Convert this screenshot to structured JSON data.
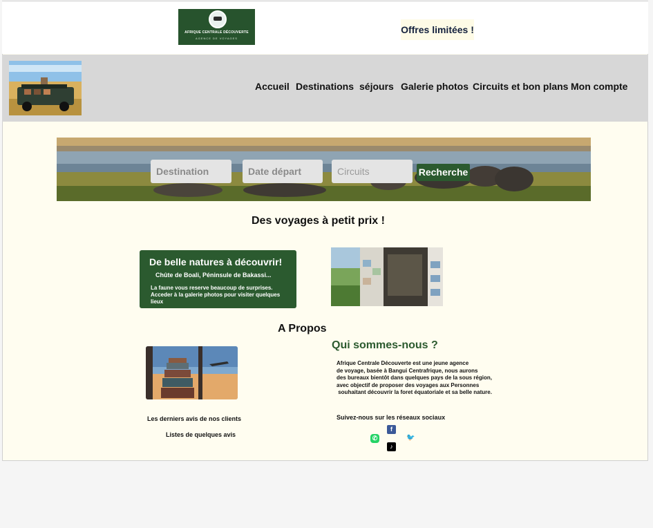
{
  "brand": {
    "logo_line1": "AFRIQUE CENTRALE DÉCOUVERTE",
    "logo_line2": "AGENCE DE VOYAGES"
  },
  "header": {
    "offres": "Offres limitées !"
  },
  "nav": {
    "items": [
      "Accueil",
      "Destinations",
      "séjours",
      "Galerie photos",
      "Circuits et bon plans",
      "Mon compte"
    ]
  },
  "search": {
    "destination": "Destination",
    "date": "Date départ",
    "circuits": "Circuits",
    "button": "Recherche"
  },
  "main": {
    "title": "Des voyages à petit prix !",
    "card": {
      "title": "De belle natures à découvrir!",
      "subtitle": "Chûte de Boali, Péninsule de Bakassi...",
      "text": "La faune vous reserve beaucoup de surprises. Acceder à la galerie photos pour visiter quelques lieux"
    }
  },
  "apropos": {
    "title": "A Propos",
    "qui": "Qui sommes-nous ?",
    "text": "Afrique Centrale Découverte est une jeune agence\nde voyage, basée à Bangui Centrafrique, nous aurons\ndes bureaux bientôt dans quelques pays de la sous région,\navec objectif de proposer des voyages aux Personnes\n souhaitant découvrir la foret équatoriale et sa belle nature.",
    "avis_title": "Les derniers avis de nos clients",
    "avis_list": "Listes de quelques avis",
    "follow": "Suivez-nous sur les réseaux sociaux"
  },
  "social": {
    "facebook": "f",
    "whatsapp": "✆",
    "twitter": "🐦",
    "tiktok": "♪"
  },
  "colors": {
    "accent": "#2b5a2f",
    "page_bg": "#fffdf0",
    "nav_bg": "#d7d7d7"
  }
}
